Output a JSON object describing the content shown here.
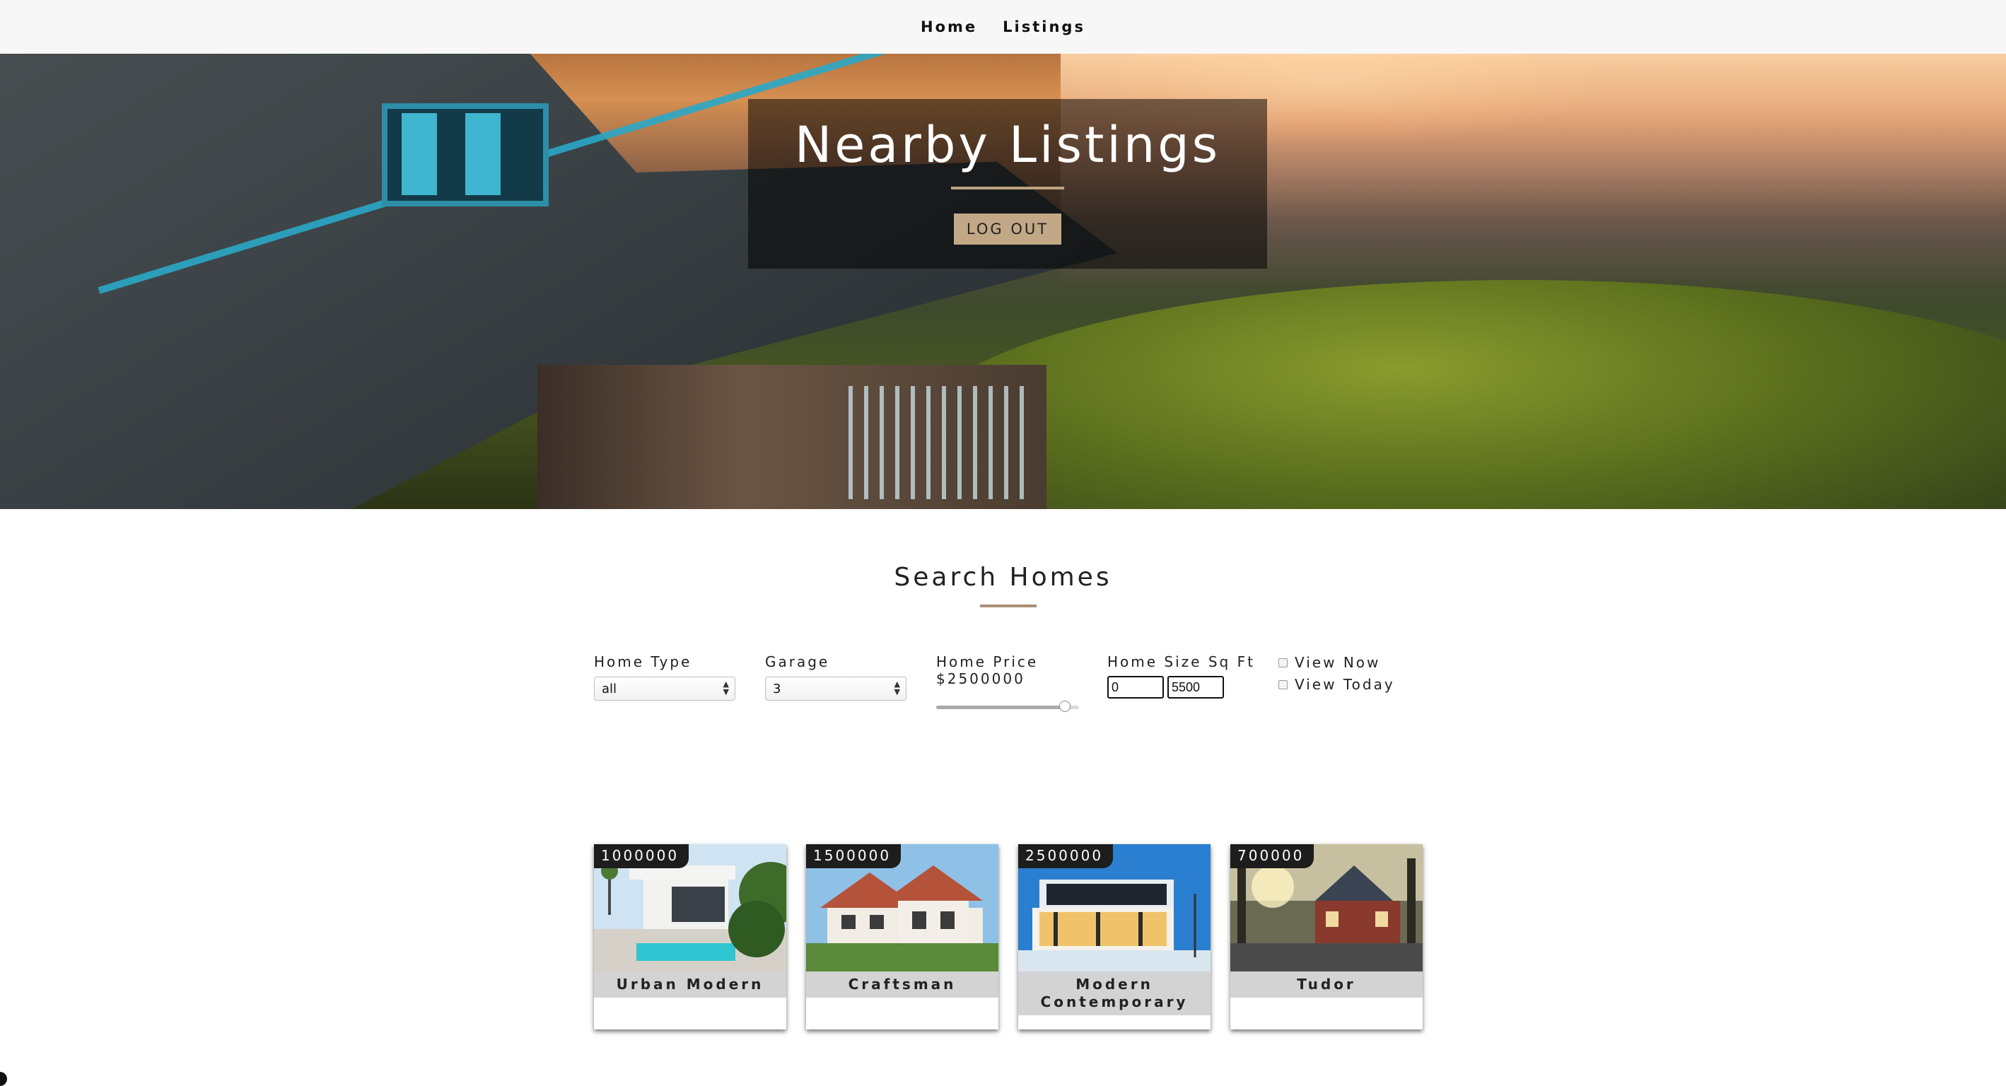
{
  "nav": {
    "links": [
      "Home",
      "Listings"
    ]
  },
  "hero": {
    "title": "Nearby Listings",
    "button": "LOG OUT"
  },
  "search": {
    "title": "Search Homes",
    "home_type": {
      "label": "Home Type",
      "value": "all"
    },
    "garage": {
      "label": "Garage",
      "value": "3"
    },
    "home_price": {
      "label": "Home Price",
      "value_text": "$2500000",
      "slider_fraction": 0.9
    },
    "home_size": {
      "label": "Home Size Sq Ft",
      "min": "0",
      "max": "5500"
    },
    "checkboxes": [
      {
        "label": "View Now",
        "checked": false
      },
      {
        "label": "View Today",
        "checked": false
      }
    ]
  },
  "listings": [
    {
      "price": "1000000",
      "name": "Urban Modern"
    },
    {
      "price": "1500000",
      "name": "Craftsman"
    },
    {
      "price": "2500000",
      "name": "Modern Contemporary"
    },
    {
      "price": "700000",
      "name": "Tudor"
    }
  ]
}
